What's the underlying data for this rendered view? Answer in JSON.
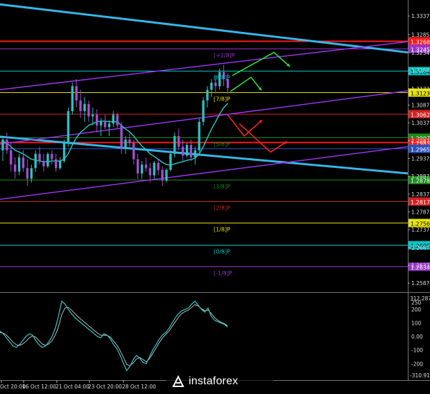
{
  "chart_data": {
    "type": "line",
    "price_axis": {
      "range": [
        1.2564,
        1.3382
      ],
      "tick_labels": [
        "1.3337",
        "1.3285",
        "1.3234",
        "1.3184",
        "1.3133",
        "1.3087",
        "1.3037",
        "1.2987",
        "1.2937",
        "1.2887",
        "1.2837",
        "1.2787",
        "1.2737",
        "1.2687",
        "1.2637",
        "1.2587"
      ],
      "tick_values": [
        1.3337,
        1.3285,
        1.3234,
        1.3184,
        1.3133,
        1.3087,
        1.3037,
        1.2987,
        1.2937,
        1.2887,
        1.2837,
        1.2787,
        1.2737,
        1.2687,
        1.2637,
        1.2587
      ]
    },
    "levels": [
      {
        "price": 1.3268,
        "label": "1.3268",
        "murrey": "",
        "color": "#ff1a1a",
        "style": "solid-thick"
      },
      {
        "price": 1.3245,
        "label": "1.3245",
        "murrey": "[+2/8]P",
        "color": "#9933cc",
        "style": "solid"
      },
      {
        "price": 1.3184,
        "label": "1.3184",
        "murrey": "[8/8]P",
        "color": "#00c8c8",
        "style": "solid"
      },
      {
        "price": 1.3123,
        "label": "1.3123",
        "murrey": "[7/8]P",
        "color": "#e6e600",
        "style": "solid"
      },
      {
        "price": 1.3062,
        "label": "1.3062",
        "murrey": "",
        "color": "#d42020",
        "style": "solid"
      },
      {
        "price": 1.2997,
        "label": "1.2997",
        "murrey": "[5/8]P",
        "color": "#1a8c1a",
        "style": "solid"
      },
      {
        "price": 1.2983,
        "label": "1.2983",
        "murrey": "",
        "color": "#ff1a1a",
        "style": "solid-thick"
      },
      {
        "price": 1.2965,
        "label": "1.2965",
        "murrey": "",
        "color": "#2a52be",
        "style": "solid"
      },
      {
        "price": 1.2878,
        "label": "1.2878",
        "murrey": "[3/8]P",
        "color": "#1a8c1a",
        "style": "solid"
      },
      {
        "price": 1.2817,
        "label": "1.2817",
        "murrey": "[2/8]P",
        "color": "#d42020",
        "style": "solid"
      },
      {
        "price": 1.2756,
        "label": "1.2756",
        "murrey": "[1/8]P",
        "color": "#e6e600",
        "style": "solid"
      },
      {
        "price": 1.2695,
        "label": "1.2695",
        "murrey": "[0/8]P",
        "color": "#00c8c8",
        "style": "solid"
      },
      {
        "price": 1.2634,
        "label": "1.2634",
        "murrey": "[-1/8]P",
        "color": "#9933cc",
        "style": "solid"
      }
    ],
    "time_axis": {
      "labels": [
        "Oct 20:00",
        "16 Oct 12:00",
        "21 Oct 04:00",
        "23 Oct 20:00",
        "28 Oct 12:00"
      ]
    },
    "candles": [
      [
        1.296,
        1.3,
        1.293,
        1.299
      ],
      [
        1.299,
        1.301,
        1.295,
        1.296
      ],
      [
        1.296,
        1.298,
        1.29,
        1.292
      ],
      [
        1.292,
        1.294,
        1.288,
        1.29
      ],
      [
        1.29,
        1.295,
        1.289,
        1.294
      ],
      [
        1.294,
        1.296,
        1.29,
        1.291
      ],
      [
        1.291,
        1.2935,
        1.286,
        1.288
      ],
      [
        1.288,
        1.292,
        1.287,
        1.291
      ],
      [
        1.291,
        1.296,
        1.29,
        1.295
      ],
      [
        1.295,
        1.297,
        1.292,
        1.293
      ],
      [
        1.293,
        1.295,
        1.29,
        1.2915
      ],
      [
        1.2915,
        1.2955,
        1.291,
        1.295
      ],
      [
        1.295,
        1.296,
        1.292,
        1.2935
      ],
      [
        1.2935,
        1.295,
        1.29,
        1.291
      ],
      [
        1.291,
        1.294,
        1.2905,
        1.293
      ],
      [
        1.293,
        1.299,
        1.2925,
        1.298
      ],
      [
        1.298,
        1.308,
        1.297,
        1.307
      ],
      [
        1.307,
        1.315,
        1.306,
        1.314
      ],
      [
        1.314,
        1.316,
        1.308,
        1.31
      ],
      [
        1.31,
        1.313,
        1.305,
        1.307
      ],
      [
        1.307,
        1.311,
        1.304,
        1.309
      ],
      [
        1.309,
        1.31,
        1.304,
        1.3055
      ],
      [
        1.3055,
        1.308,
        1.303,
        1.306
      ],
      [
        1.306,
        1.3075,
        1.301,
        1.303
      ],
      [
        1.303,
        1.305,
        1.3,
        1.304
      ],
      [
        1.304,
        1.306,
        1.302,
        1.3025
      ],
      [
        1.3025,
        1.3045,
        1.3,
        1.3035
      ],
      [
        1.3035,
        1.307,
        1.3025,
        1.306
      ],
      [
        1.306,
        1.3065,
        1.302,
        1.303
      ],
      [
        1.303,
        1.304,
        1.295,
        1.2965
      ],
      [
        1.2965,
        1.3,
        1.295,
        1.299
      ],
      [
        1.299,
        1.301,
        1.297,
        1.298
      ],
      [
        1.298,
        1.299,
        1.292,
        1.2935
      ],
      [
        1.2935,
        1.295,
        1.288,
        1.2895
      ],
      [
        1.2895,
        1.293,
        1.288,
        1.292
      ],
      [
        1.292,
        1.294,
        1.29,
        1.291
      ],
      [
        1.291,
        1.2925,
        1.287,
        1.289
      ],
      [
        1.289,
        1.293,
        1.288,
        1.2925
      ],
      [
        1.2925,
        1.2935,
        1.289,
        1.2905
      ],
      [
        1.2905,
        1.2915,
        1.286,
        1.2875
      ],
      [
        1.2875,
        1.291,
        1.287,
        1.2905
      ],
      [
        1.2905,
        1.296,
        1.29,
        1.295
      ],
      [
        1.295,
        1.301,
        1.294,
        1.3
      ],
      [
        1.3,
        1.302,
        1.296,
        1.297
      ],
      [
        1.297,
        1.299,
        1.293,
        1.2945
      ],
      [
        1.2945,
        1.298,
        1.294,
        1.2975
      ],
      [
        1.2975,
        1.299,
        1.293,
        1.294
      ],
      [
        1.294,
        1.297,
        1.292,
        1.296
      ],
      [
        1.296,
        1.305,
        1.2955,
        1.304
      ],
      [
        1.304,
        1.311,
        1.303,
        1.31
      ],
      [
        1.31,
        1.314,
        1.308,
        1.313
      ],
      [
        1.313,
        1.316,
        1.311,
        1.315
      ],
      [
        1.315,
        1.317,
        1.312,
        1.314
      ],
      [
        1.314,
        1.319,
        1.313,
        1.318
      ],
      [
        1.318,
        1.32,
        1.314,
        1.316
      ],
      [
        1.316,
        1.3175,
        1.312,
        1.3135
      ]
    ],
    "moving_average": [
      1.2985,
      1.298,
      1.297,
      1.296,
      1.2955,
      1.295,
      1.2942,
      1.2935,
      1.2932,
      1.293,
      1.2928,
      1.2928,
      1.293,
      1.293,
      1.293,
      1.2935,
      1.295,
      1.2975,
      1.2995,
      1.301,
      1.302,
      1.303,
      1.3035,
      1.304,
      1.3042,
      1.3042,
      1.304,
      1.304,
      1.304,
      1.303,
      1.302,
      1.3012,
      1.3,
      1.2985,
      1.2972,
      1.2962,
      1.295,
      1.2943,
      1.2935,
      1.2926,
      1.292,
      1.2918,
      1.2922,
      1.2925,
      1.2928,
      1.2932,
      1.2934,
      1.2938,
      1.295,
      1.297,
      1.2995,
      1.302,
      1.304,
      1.3062,
      1.308,
      1.3092
    ],
    "channels": [
      {
        "name": "",
        "color": "#35b6e8",
        "width": 3,
        "from": [
          -10,
          1.3372
        ],
        "to": [
          588,
          1.3235
        ]
      },
      {
        "name": "",
        "color": "#35b6e8",
        "width": 3,
        "from": [
          -10,
          1.3
        ],
        "to": [
          588,
          1.2895
        ]
      },
      {
        "name": "",
        "color": "#9933ee",
        "width": 1.5,
        "from": [
          -10,
          1.3128
        ],
        "to": [
          588,
          1.3265
        ]
      },
      {
        "name": "",
        "color": "#9933ee",
        "width": 1.5,
        "from": [
          -10,
          1.2975
        ],
        "to": [
          588,
          1.3127
        ]
      },
      {
        "name": "",
        "color": "#9933ee",
        "width": 1.5,
        "from": [
          -10,
          1.282
        ],
        "to": [
          588,
          1.297
        ]
      }
    ],
    "forecast_arrows": [
      {
        "color": "#2ee02e",
        "points": [
          [
            332,
            1.3125
          ],
          [
            362,
            1.3165
          ],
          [
            377,
            1.3128
          ]
        ]
      },
      {
        "color": "#2ee02e",
        "points": [
          [
            335,
            1.317
          ],
          [
            395,
            1.3235
          ],
          [
            418,
            1.3195
          ]
        ]
      },
      {
        "color": "#ff2020",
        "points": [
          [
            328,
            1.306
          ],
          [
            352,
            1.3
          ],
          [
            378,
            1.3045
          ]
        ]
      },
      {
        "color": "#ff2020",
        "points": [
          [
            345,
            1.3035
          ],
          [
            390,
            1.2955
          ],
          [
            414,
            1.2985
          ]
        ]
      }
    ],
    "oscillator": {
      "type": "CCI",
      "range": [
        -310.914,
        312.2872
      ],
      "top_label": "312.2872",
      "bottom_label": "-310.914",
      "tick_labels": [
        "250",
        "200",
        "100",
        "0.00",
        "-100",
        "-200"
      ],
      "tick_values": [
        250,
        200,
        100,
        0,
        -100,
        -200
      ],
      "values": [
        40,
        20,
        -10,
        -40,
        -70,
        -80,
        -60,
        -30,
        0,
        20,
        10,
        -30,
        -60,
        -80,
        -70,
        -40,
        0,
        60,
        150,
        260,
        240,
        200,
        170,
        140,
        120,
        100,
        80,
        60,
        40,
        20,
        0,
        -10,
        20,
        10,
        -20,
        -60,
        -90,
        -140,
        -200,
        -250,
        -220,
        -170,
        -140,
        -160,
        -190,
        -200,
        -150,
        -100,
        -60,
        -20,
        10,
        30,
        60,
        100,
        140,
        170,
        190,
        200,
        210,
        240,
        260,
        230,
        200,
        180,
        210,
        150,
        120,
        110,
        100,
        90,
        70
      ],
      "ma_values": [
        30,
        25,
        10,
        -15,
        -40,
        -60,
        -65,
        -55,
        -35,
        -10,
        5,
        -5,
        -30,
        -55,
        -65,
        -55,
        -30,
        10,
        70,
        160,
        210,
        215,
        195,
        170,
        145,
        125,
        105,
        85,
        65,
        45,
        25,
        10,
        10,
        8,
        -5,
        -35,
        -65,
        -105,
        -155,
        -205,
        -215,
        -195,
        -165,
        -155,
        -170,
        -185,
        -165,
        -125,
        -85,
        -45,
        -10,
        15,
        40,
        75,
        110,
        145,
        170,
        185,
        195,
        215,
        235,
        225,
        205,
        190,
        195,
        170,
        140,
        120,
        105,
        95,
        80
      ]
    }
  },
  "brand": {
    "name": "instaforex"
  }
}
